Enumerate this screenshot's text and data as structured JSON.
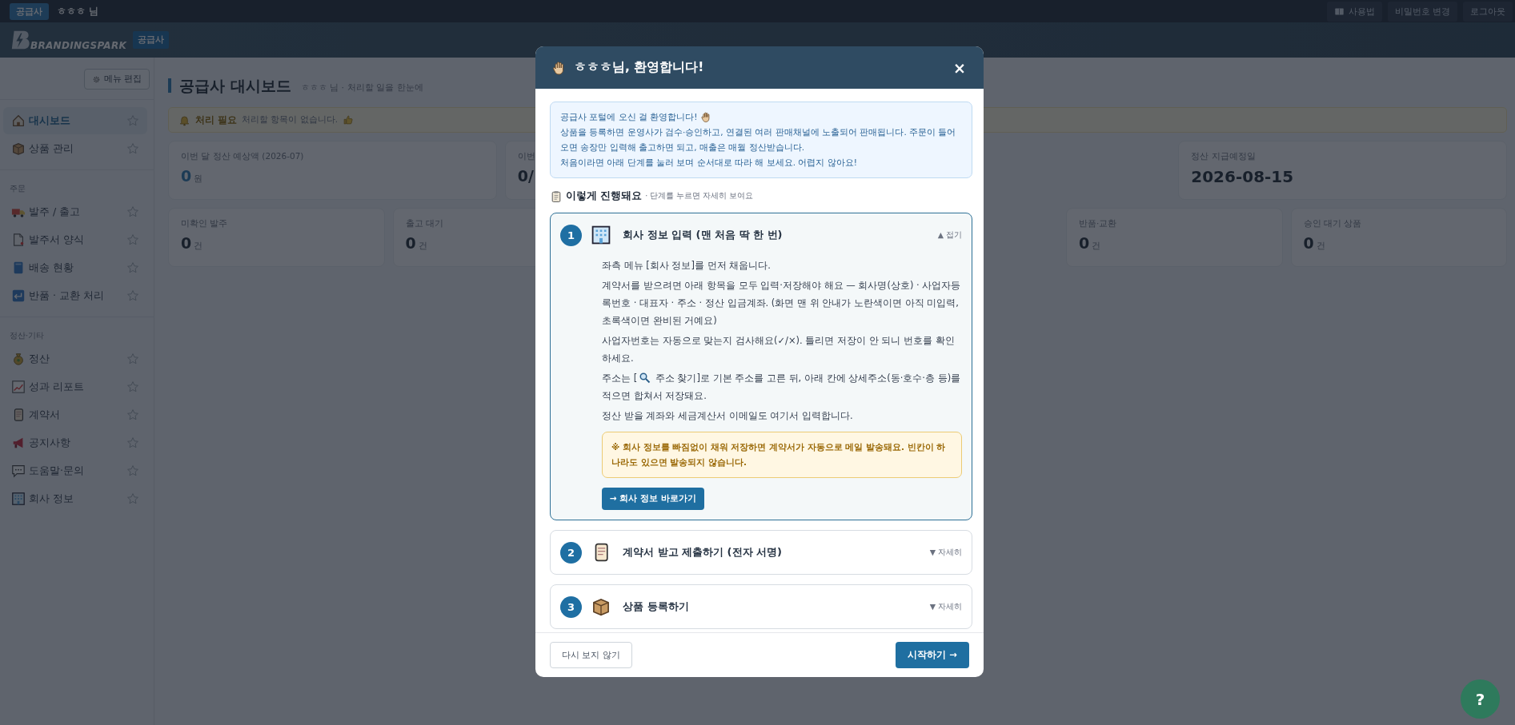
{
  "topbar": {
    "role_badge": "공급사",
    "user": "ㅎㅎㅎ 님",
    "buttons": [
      {
        "label": "사용법",
        "kind": "guide"
      },
      {
        "label": "비밀번호 변경",
        "kind": "plain"
      },
      {
        "label": "로그아웃",
        "kind": "plain"
      }
    ]
  },
  "header": {
    "logo": "BRANDINGSPARK",
    "badge": "공급사"
  },
  "sidebar": {
    "edit_button": "메뉴 편집",
    "sections": [
      {
        "items": [
          {
            "label": "대시보드",
            "selected": true
          },
          {
            "label": "상품 관리",
            "selected": false
          }
        ]
      },
      {
        "title": "주문",
        "items": [
          {
            "label": "발주 / 출고",
            "selected": false
          },
          {
            "label": "발주서 양식",
            "selected": false
          },
          {
            "label": "배송 현황",
            "selected": false
          },
          {
            "label": "반품 · 교환 처리",
            "selected": false
          }
        ]
      },
      {
        "title": "정산·기타",
        "items": [
          {
            "label": "정산",
            "selected": false
          },
          {
            "label": "성과 리포트",
            "selected": false
          },
          {
            "label": "계약서",
            "selected": false
          },
          {
            "label": "공지사항",
            "selected": false
          },
          {
            "label": "도움말·문의",
            "selected": false
          },
          {
            "label": "회사 정보",
            "selected": false
          }
        ]
      }
    ]
  },
  "page": {
    "title": "공급사 대시보드",
    "subtitle": "ㅎㅎㅎ 님 · 처리할 일을 한눈에",
    "alert": {
      "title": "처리 필요",
      "message": "처리할 항목이 없습니다."
    },
    "summary_cards": [
      {
        "label": "이번 달 정산 예상액 (2026-07)",
        "value": "0",
        "unit": "원",
        "kind": "amount"
      },
      {
        "label": "이번",
        "value": "0/",
        "kind": "ratio"
      },
      {
        "label": "정산 지급예정일",
        "value": "2026-08-15",
        "kind": "date"
      }
    ],
    "count_cards": [
      {
        "label": "미확인 발주",
        "value": "0",
        "unit": "건"
      },
      {
        "label": "출고 대기",
        "value": "0",
        "unit": "건"
      },
      {
        "label": "반품·교환",
        "value": "0",
        "unit": "건"
      },
      {
        "label": "승인 대기 상품",
        "value": "0",
        "unit": "건"
      }
    ]
  },
  "welcome_modal": {
    "title": "ㅎㅎㅎ님, 환영합니다!",
    "close": "×",
    "intro": [
      "공급사 포털에 오신 걸 환영합니다!",
      "상품을 등록하면 운영사가 검수·승인하고, 연결된 여러 판매채널에 노출되어 판매됩니다. 주문이 들어오면 송장만 입력해 출고하면 되고, 매출은 매월 정산받습니다.",
      "처음이라면 아래 단계를 눌러 보며 순서대로 따라 해 보세요. 어렵지 않아요!"
    ],
    "steps_heading": "이렇게 진행돼요",
    "steps_hint": "· 단계를 누르면 자세히 보여요",
    "steps": [
      {
        "number": "1",
        "title": "회사 정보 입력 (맨 처음 딱 한 번)",
        "toggle": "▲ 접기",
        "expanded": true,
        "paragraphs": [
          {
            "kind": "text",
            "text": "좌측 메뉴 [회사 정보]를 먼저 채웁니다."
          },
          {
            "kind": "text",
            "text": "계약서를 받으려면 아래 항목을 모두 입력·저장해야 해요 — 회사명(상호) · 사업자등록번호 · 대표자 · 주소 · 정산 입금계좌. (화면 맨 위 안내가 노란색이면 아직 미입력, 초록색이면 완비된 거예요)"
          },
          {
            "kind": "text",
            "text": "사업자번호는 자동으로 맞는지 검사해요(✓/×). 틀리면 저장이 안 되니 번호를 확인하세요."
          },
          {
            "kind": "search_ref",
            "before": "주소는 [",
            "after": " 주소 찾기]로 기본 주소를 고른 뒤, 아래 칸에 상세주소(동·호수·층 등)를 적으면 합쳐서 저장돼요."
          },
          {
            "kind": "text",
            "text": "정산 받을 계좌와 세금계산서 이메일도 여기서 입력합니다."
          }
        ],
        "note": "※ 회사 정보를 빠짐없이 채워 저장하면 계약서가 자동으로 메일 발송돼요. 빈칸이 하나라도 있으면 발송되지 않습니다.",
        "action": "→ 회사 정보 바로가기"
      },
      {
        "number": "2",
        "title": "계약서 받고 제출하기 (전자 서명)",
        "toggle": "▼ 자세히",
        "expanded": false
      },
      {
        "number": "3",
        "title": "상품 등록하기",
        "toggle": "▼ 자세히",
        "expanded": false
      }
    ],
    "dismiss_button": "다시 보지 않기",
    "start_button": "시작하기 →"
  },
  "help_button": "?"
}
